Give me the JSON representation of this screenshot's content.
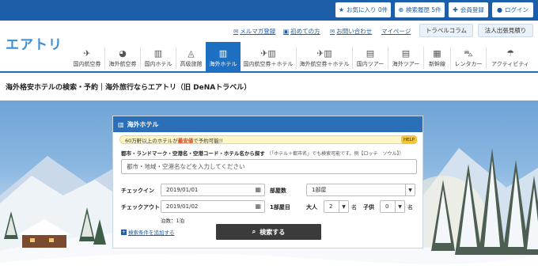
{
  "topbar": {
    "favorites": "お気に入り 0件",
    "history": "検索履歴 5件",
    "register": "会員登録",
    "login": "ログイン"
  },
  "header": {
    "logo": "エアトリ",
    "links": {
      "mail": "メルマガ登録",
      "first": "初めての方",
      "contact": "お問い合わせ",
      "mypage": "マイページ"
    },
    "travel_column": "トラベルコラム",
    "corporate": "法人出張見積り"
  },
  "nav": {
    "tabs": [
      {
        "label": "国内航空券",
        "icon": "airplane-icon"
      },
      {
        "label": "海外航空券",
        "icon": "globe-plane-icon"
      },
      {
        "label": "国内ホテル",
        "icon": "building-icon"
      },
      {
        "label": "高級旅館",
        "icon": "ryokan-icon"
      },
      {
        "label": "海外ホテル",
        "icon": "building-icon"
      },
      {
        "label": "国内航空券＋ホテル",
        "icon": "plane-building-icon"
      },
      {
        "label": "海外航空券＋ホテル",
        "icon": "plane-building-icon"
      },
      {
        "label": "国内ツアー",
        "icon": "suitcase-icon"
      },
      {
        "label": "海外ツアー",
        "icon": "suitcase-icon"
      },
      {
        "label": "新幹線",
        "icon": "train-icon"
      },
      {
        "label": "レンタカー",
        "icon": "car-icon"
      },
      {
        "label": "アクティビティ",
        "icon": "umbrella-icon"
      }
    ],
    "active_index": 4
  },
  "page": {
    "title": "海外格安ホテルの検索・予約｜海外旅行ならエアトリ（旧 DeNAトラベル）"
  },
  "search": {
    "panel_title": "海外ホテル",
    "promo_prefix": "60万軒以上のホテルが",
    "promo_highlight": "最安値",
    "promo_suffix": "で予約可能!!",
    "help": "HELP",
    "dest_label": "都市・ランドマーク・空港名・空港コード・ホテル名から探す",
    "dest_note": "（「ホテル＋都市名」でも検索可能です。例【ロッテ　ソウル】）",
    "dest_placeholder": "都市・地域・空港名などを入力してください",
    "checkin_label": "チェックイン",
    "checkin_value": "2019/01/01",
    "checkout_label": "チェックアウト",
    "checkout_value": "2019/01/02",
    "rooms_label": "部屋数",
    "rooms_value": "1部屋",
    "room1_label": "1部屋目",
    "adults_label": "大人",
    "adults_value": "2",
    "adults_unit": "名",
    "children_label": "子供",
    "children_value": "0",
    "children_unit": "名",
    "nights": "泊数：1泊",
    "more_conditions": "検索条件を追加する",
    "search_button": "検索する"
  },
  "colors": {
    "brand_blue": "#1d5ea8",
    "active_tab": "#1d6fc2",
    "promo_red": "#d63b1f",
    "search_button": "#3b3b3b"
  }
}
